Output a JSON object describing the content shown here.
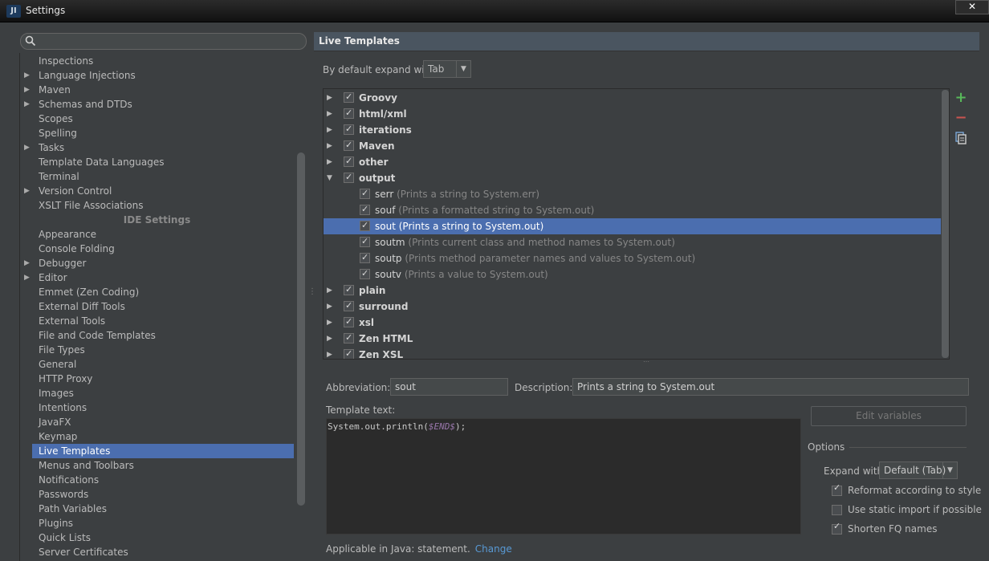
{
  "window": {
    "title": "Settings",
    "app_icon": "JI",
    "close": "✕"
  },
  "search": {
    "placeholder": ""
  },
  "left_tree": {
    "items_top": [
      {
        "label": "Inspections",
        "expandable": false
      },
      {
        "label": "Language Injections",
        "expandable": true
      },
      {
        "label": "Maven",
        "expandable": true
      },
      {
        "label": "Schemas and DTDs",
        "expandable": true
      },
      {
        "label": "Scopes",
        "expandable": false
      },
      {
        "label": "Spelling",
        "expandable": false
      },
      {
        "label": "Tasks",
        "expandable": true
      },
      {
        "label": "Template Data Languages",
        "expandable": false
      },
      {
        "label": "Terminal",
        "expandable": false
      },
      {
        "label": "Version Control",
        "expandable": true
      },
      {
        "label": "XSLT File Associations",
        "expandable": false
      }
    ],
    "section_header": "IDE Settings",
    "items_ide": [
      {
        "label": "Appearance",
        "expandable": false
      },
      {
        "label": "Console Folding",
        "expandable": false
      },
      {
        "label": "Debugger",
        "expandable": true
      },
      {
        "label": "Editor",
        "expandable": true
      },
      {
        "label": "Emmet (Zen Coding)",
        "expandable": false
      },
      {
        "label": "External Diff Tools",
        "expandable": false
      },
      {
        "label": "External Tools",
        "expandable": false
      },
      {
        "label": "File and Code Templates",
        "expandable": false
      },
      {
        "label": "File Types",
        "expandable": false
      },
      {
        "label": "General",
        "expandable": false
      },
      {
        "label": "HTTP Proxy",
        "expandable": false
      },
      {
        "label": "Images",
        "expandable": false
      },
      {
        "label": "Intentions",
        "expandable": false
      },
      {
        "label": "JavaFX",
        "expandable": false
      },
      {
        "label": "Keymap",
        "expandable": false
      },
      {
        "label": "Live Templates",
        "expandable": false,
        "selected": true
      },
      {
        "label": "Menus and Toolbars",
        "expandable": false
      },
      {
        "label": "Notifications",
        "expandable": false
      },
      {
        "label": "Passwords",
        "expandable": false
      },
      {
        "label": "Path Variables",
        "expandable": false
      },
      {
        "label": "Plugins",
        "expandable": false
      },
      {
        "label": "Quick Lists",
        "expandable": false
      },
      {
        "label": "Server Certificates",
        "expandable": false
      }
    ]
  },
  "right": {
    "title": "Live Templates",
    "expand_label": "By default expand with",
    "expand_value": "Tab",
    "groups": [
      {
        "name": "Groovy",
        "expanded": false,
        "checked": true
      },
      {
        "name": "html/xml",
        "expanded": false,
        "checked": true
      },
      {
        "name": "iterations",
        "expanded": false,
        "checked": true
      },
      {
        "name": "Maven",
        "expanded": false,
        "checked": true
      },
      {
        "name": "other",
        "expanded": false,
        "checked": true
      },
      {
        "name": "output",
        "expanded": true,
        "checked": true,
        "templates": [
          {
            "abbr": "serr",
            "desc": "(Prints a string to System.err)"
          },
          {
            "abbr": "souf",
            "desc": "(Prints a formatted string to System.out)"
          },
          {
            "abbr": "sout",
            "desc": "(Prints a string to System.out)",
            "selected": true
          },
          {
            "abbr": "soutm",
            "desc": "(Prints current class and method names to System.out)"
          },
          {
            "abbr": "soutp",
            "desc": "(Prints method parameter names and values to System.out)"
          },
          {
            "abbr": "soutv",
            "desc": "(Prints a value to System.out)"
          }
        ]
      },
      {
        "name": "plain",
        "expanded": false,
        "checked": true
      },
      {
        "name": "surround",
        "expanded": false,
        "checked": true
      },
      {
        "name": "xsl",
        "expanded": false,
        "checked": true
      },
      {
        "name": "Zen HTML",
        "expanded": false,
        "checked": true
      },
      {
        "name": "Zen XSL",
        "expanded": false,
        "checked": true
      }
    ],
    "toolbar": {
      "add": "+",
      "remove": "−"
    },
    "form": {
      "abbreviation_label": "Abbreviation:",
      "abbreviation_value": "sout",
      "description_label": "Description:",
      "description_value": "Prints a string to System.out",
      "template_text_label": "Template text:",
      "template_code_prefix": "System.out.println(",
      "template_code_var": "$END$",
      "template_code_suffix": ");",
      "applicable_text": "Applicable in Java: statement.",
      "change_link": "Change"
    },
    "edit_variables": "Edit variables",
    "options": {
      "title": "Options",
      "expand_with_label": "Expand with",
      "expand_with_value": "Default (Tab)",
      "reformat": {
        "label": "Reformat according to style",
        "checked": true
      },
      "static_import": {
        "label": "Use static import if possible",
        "checked": false
      },
      "shorten_fq": {
        "label": "Shorten FQ names",
        "checked": true
      }
    }
  },
  "colors": {
    "accent": "#4b6eaf",
    "add": "#58b85a",
    "remove": "#c75450",
    "link": "#5899d4"
  }
}
